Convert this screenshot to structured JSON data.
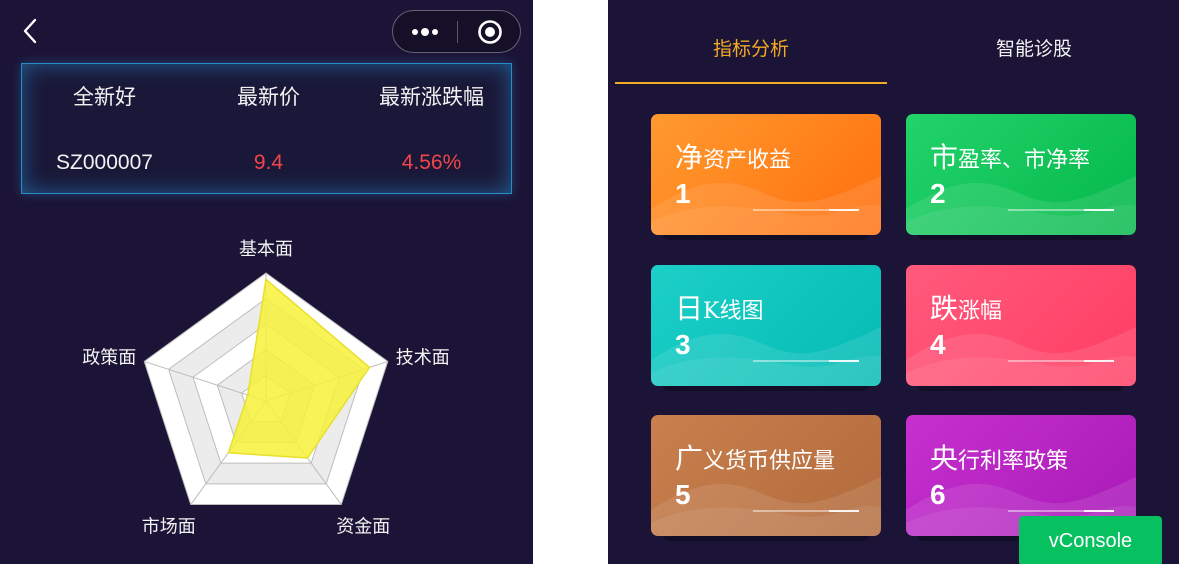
{
  "left_screen": {
    "stock_table": {
      "headers": [
        "全新好",
        "最新价",
        "最新涨跌幅"
      ],
      "code": "SZ000007",
      "price": "9.4",
      "change": "4.56%"
    },
    "radar": {
      "axes": [
        "基本面",
        "技术面",
        "资金面",
        "市场面",
        "政策面"
      ],
      "levels": 5,
      "values": [
        0.95,
        0.85,
        0.55,
        0.5,
        0.15
      ],
      "fill_color": "#f7f23a",
      "fill_opacity": 0.85
    }
  },
  "right_screen": {
    "tabs": [
      {
        "label": "指标分析",
        "active": true
      },
      {
        "label": "智能诊股",
        "active": false
      }
    ],
    "accent_color": "#f2a924",
    "cards": [
      {
        "title_big": "净",
        "title_rest": "资产收益",
        "number": "1",
        "color_from": "#ff9a2e",
        "color_to": "#ff6f0f"
      },
      {
        "title_big": "市",
        "title_rest": "盈率、市净率",
        "number": "2",
        "color_from": "#22d36a",
        "color_to": "#05b84a"
      },
      {
        "title_big": "日",
        "title_rest": "K线图",
        "number": "3",
        "color_from": "#1cd0c8",
        "color_to": "#04bab3"
      },
      {
        "title_big": "跌",
        "title_rest": "涨幅",
        "number": "4",
        "color_from": "#ff5a7c",
        "color_to": "#ff3d63"
      },
      {
        "title_big": "广",
        "title_rest": "义货币供应量",
        "number": "5",
        "color_from": "#c8804e",
        "color_to": "#b26a3c"
      },
      {
        "title_big": "央",
        "title_rest": "行利率政策",
        "number": "6",
        "color_from": "#c630cf",
        "color_to": "#a81ab7"
      }
    ],
    "vconsole_label": "vConsole"
  }
}
